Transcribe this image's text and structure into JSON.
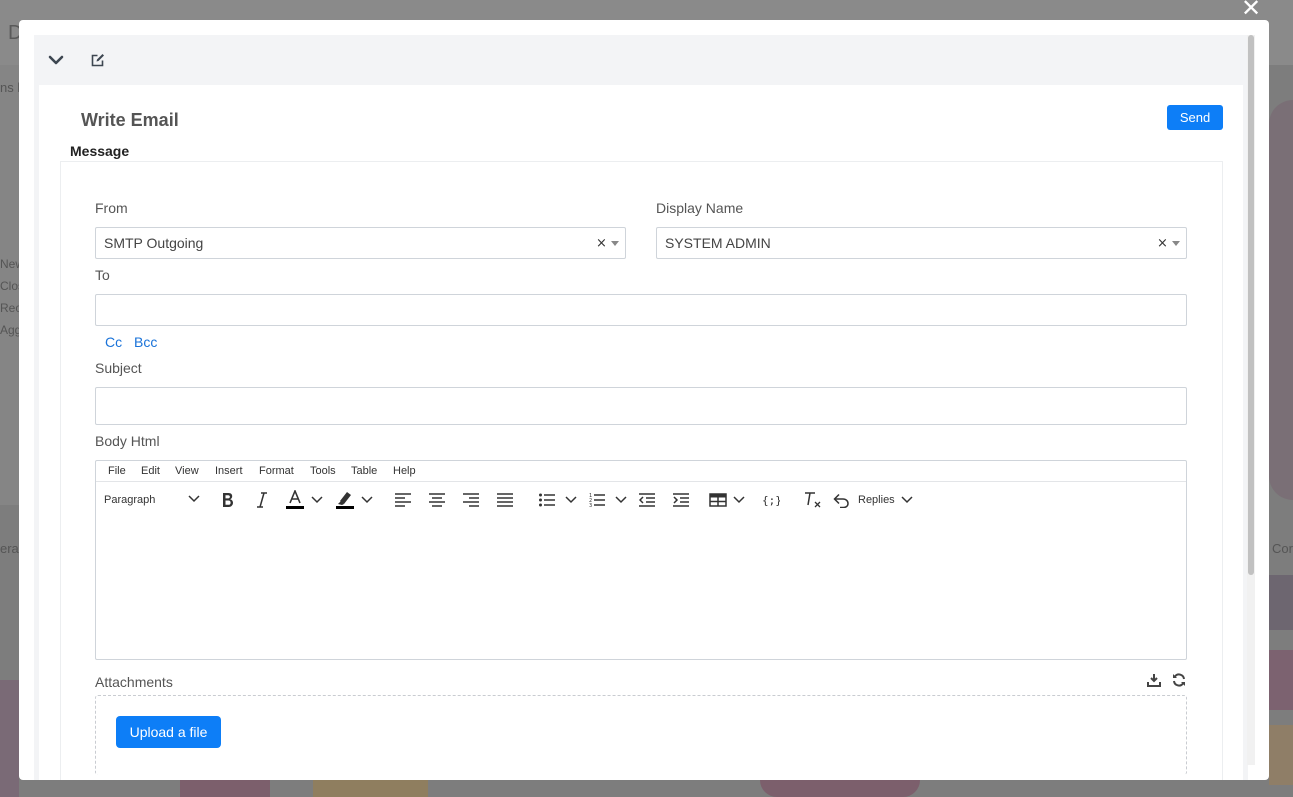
{
  "background": {
    "fragments": [
      "D",
      "ns b",
      "New",
      "Clos",
      "Reop",
      "Aggi",
      "era",
      "Cor"
    ]
  },
  "modal": {
    "close_icon": "close-icon",
    "header_icons": [
      "chevron-down-icon",
      "edit-icon"
    ],
    "title": "Write Email",
    "send_label": "Send",
    "section_label": "Message"
  },
  "form": {
    "from": {
      "label": "From",
      "value": "SMTP Outgoing",
      "clear": "×"
    },
    "display_name": {
      "label": "Display Name",
      "value": "SYSTEM ADMIN",
      "clear": "×"
    },
    "to": {
      "label": "To",
      "value": "",
      "placeholder": ""
    },
    "cc_label": "Cc",
    "bcc_label": "Bcc",
    "subject": {
      "label": "Subject",
      "value": "",
      "placeholder": ""
    },
    "body_label": "Body Html"
  },
  "editor": {
    "menu": [
      "File",
      "Edit",
      "View",
      "Insert",
      "Format",
      "Tools",
      "Table",
      "Help"
    ],
    "block_format": "Paragraph",
    "replies_label": "Replies",
    "toolbar_icons": [
      "bold-icon",
      "italic-icon",
      "text-color-icon",
      "highlight-icon",
      "align-left-icon",
      "align-center-icon",
      "align-right-icon",
      "align-justify-icon",
      "bullet-list-icon",
      "numbered-list-icon",
      "outdent-icon",
      "indent-icon",
      "table-icon",
      "code-sample-icon",
      "clear-format-icon",
      "undo-icon"
    ]
  },
  "attachments": {
    "label": "Attachments",
    "upload_label": "Upload a file",
    "icons": [
      "download-icon",
      "refresh-icon"
    ]
  },
  "colors": {
    "primary": "#0d7ef7",
    "link": "#1a73d9",
    "overlay": "#7d7d7d"
  }
}
